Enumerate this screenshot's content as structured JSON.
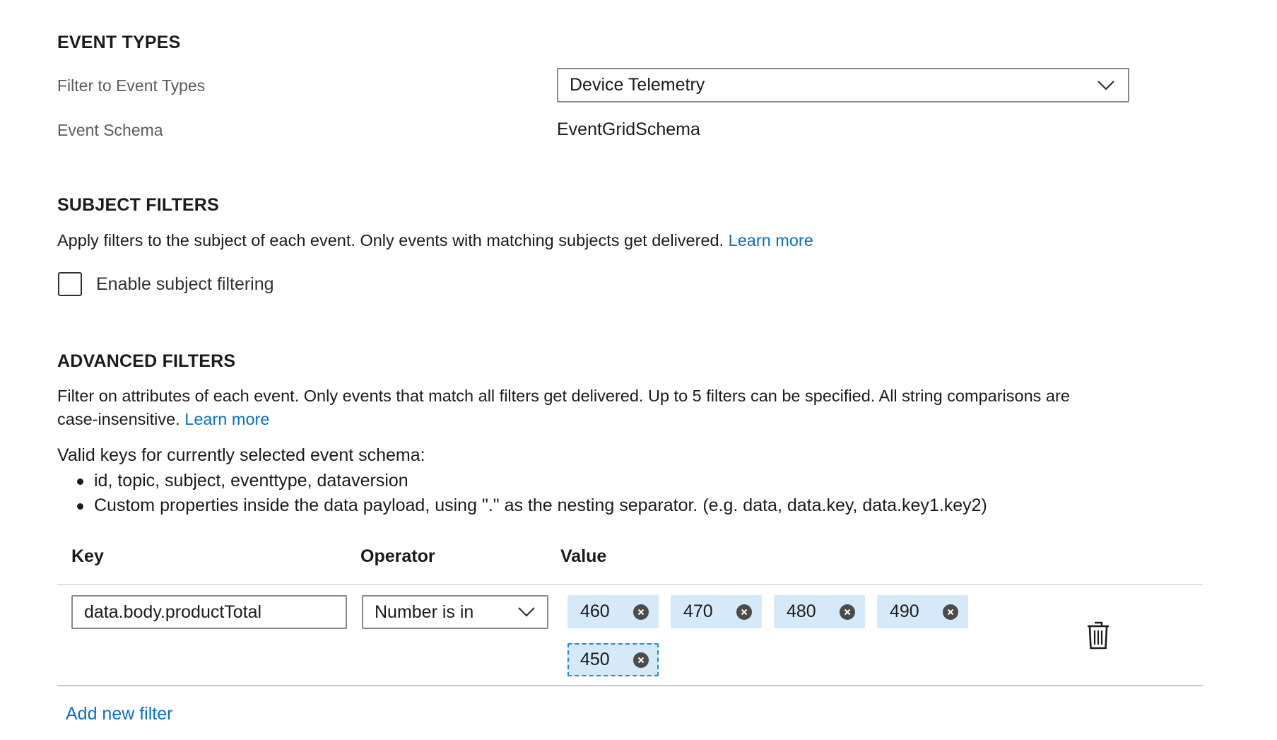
{
  "event_types": {
    "title": "EVENT TYPES",
    "filter_label": "Filter to Event Types",
    "filter_value": "Device Telemetry",
    "schema_label": "Event Schema",
    "schema_value": "EventGridSchema"
  },
  "subject_filters": {
    "title": "SUBJECT FILTERS",
    "description": "Apply filters to the subject of each event. Only events with matching subjects get delivered.",
    "learn_more": "Learn more",
    "checkbox_label": "Enable subject filtering",
    "checkbox_checked": false
  },
  "advanced_filters": {
    "title": "ADVANCED FILTERS",
    "description_line1": "Filter on attributes of each event. Only events that match all filters get delivered. Up to 5 filters can be specified. All string comparisons are",
    "description_line2": "case-insensitive.",
    "learn_more": "Learn more",
    "valid_keys_heading": "Valid keys for currently selected event schema:",
    "valid_keys": [
      "id, topic, subject, eventtype, dataversion",
      "Custom properties inside the data payload, using \".\" as the nesting separator. (e.g. data, data.key, data.key1.key2)"
    ],
    "table": {
      "key_header": "Key",
      "operator_header": "Operator",
      "value_header": "Value",
      "row": {
        "key": "data.body.productTotal",
        "operator": "Number is in",
        "values": [
          "460",
          "470",
          "480",
          "490",
          "450"
        ]
      }
    },
    "add_filter": "Add new filter"
  },
  "colors": {
    "link": "#0a6fc2",
    "chip_background": "#d6e9f8",
    "chip_focus_border": "#1d8de3"
  }
}
